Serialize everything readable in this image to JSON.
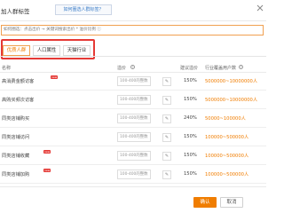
{
  "dialog": {
    "title": "加人群标签",
    "how_button": "如何圈选人群标签？"
  },
  "description": "如何圈选：点击出价 → 关键词搜索出价 * 溢价比例 ⓘ",
  "tabs": [
    {
      "label": "优质人群",
      "active": true
    },
    {
      "label": "人口属性",
      "active": false
    },
    {
      "label": "天猫行业",
      "active": false
    }
  ],
  "columns": {
    "name": "名称",
    "bid": "溢价",
    "suggested_bid": "建议溢价",
    "scale": "行业覆盖用户数",
    "help_icon": "?"
  },
  "rows": [
    {
      "name": "高消费金额访客",
      "new_badge": "new",
      "bid_placeholder": "100-400的整数",
      "edit_icon": "✎",
      "suggested_bid": "150%",
      "scale": "5000000~10000000人"
    },
    {
      "name": "高购买频次访客",
      "new_badge": "",
      "bid_placeholder": "100-400的整数",
      "edit_icon": "✎",
      "suggested_bid": "150%",
      "scale": "5000000~10000000人"
    },
    {
      "name": "同类店铺购买",
      "new_badge": "",
      "bid_placeholder": "100-400的整数",
      "edit_icon": "✎",
      "suggested_bid": "240%",
      "scale": "50000~100000人"
    },
    {
      "name": "同类店铺访问",
      "new_badge": "",
      "bid_placeholder": "100-400的整数",
      "edit_icon": "✎",
      "suggested_bid": "150%",
      "scale": "100000~500000人"
    },
    {
      "name": "同类店铺收藏",
      "new_badge": "new",
      "bid_placeholder": "100-400的整数",
      "edit_icon": "✎",
      "suggested_bid": "150%",
      "scale": "100000~500000人"
    },
    {
      "name": "同类店铺加购",
      "new_badge": "new",
      "bid_placeholder": "100-400的整数",
      "edit_icon": "✎",
      "suggested_bid": "150%",
      "scale": "100000~500000人"
    }
  ],
  "footer": {
    "confirm": "确认",
    "cancel": "取消"
  },
  "colors": {
    "accent": "#f07d00",
    "highlight_frame": "#e53935",
    "link": "#3a7cc8"
  },
  "icons": {
    "close": "close-icon",
    "edit": "pencil-icon",
    "help": "help-icon"
  }
}
